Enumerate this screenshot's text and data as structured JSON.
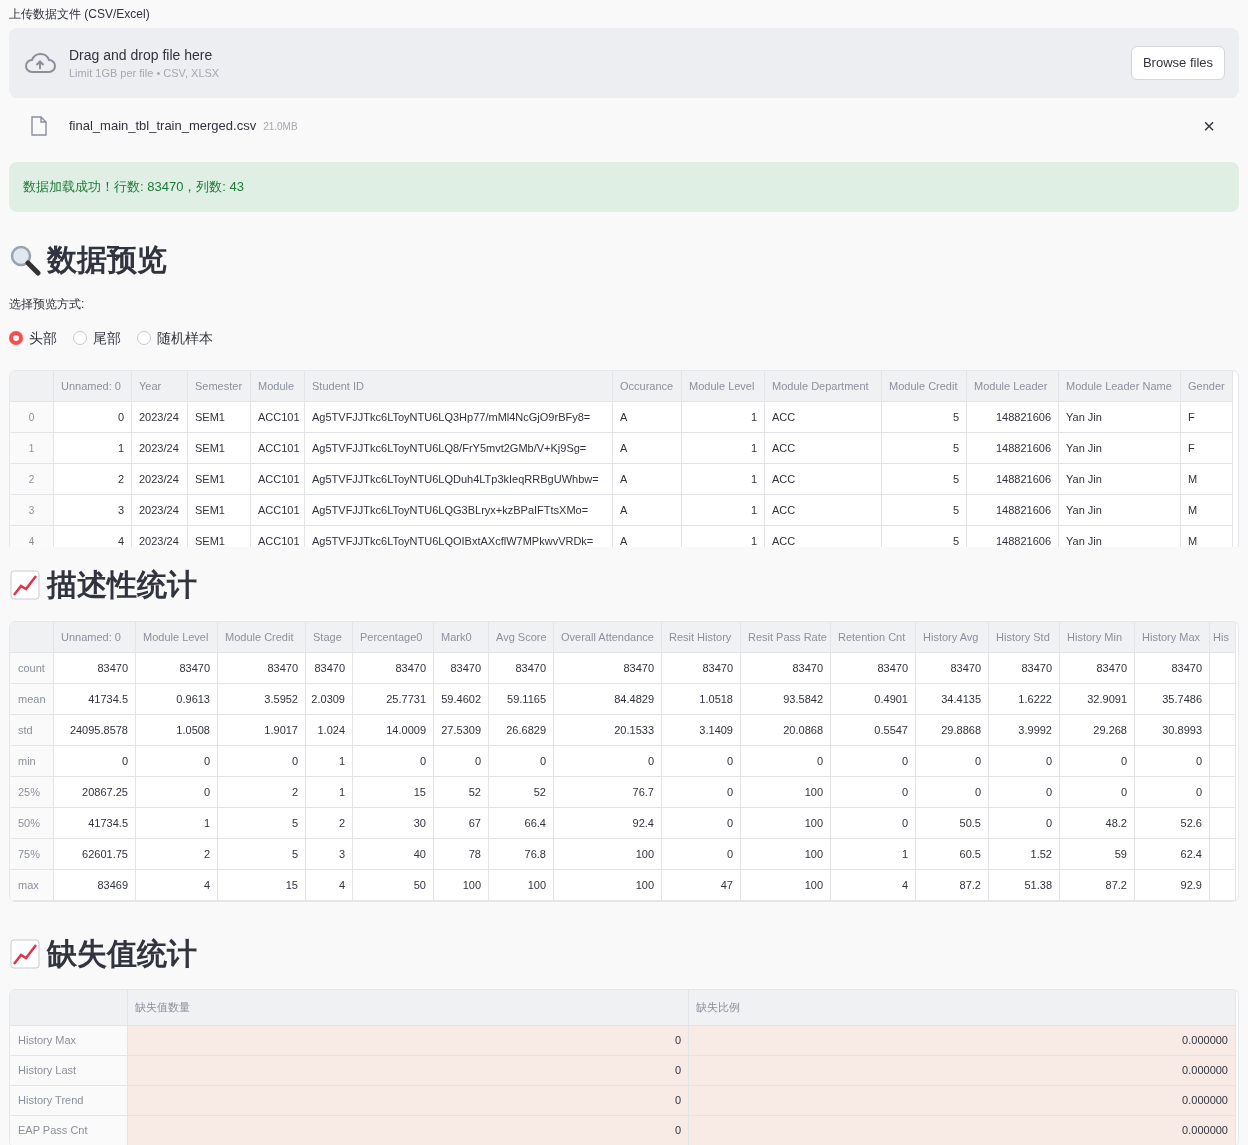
{
  "upload": {
    "label": "上传数据文件 (CSV/Excel)",
    "drop_title": "Drag and drop file here",
    "drop_hint": "Limit 1GB per file • CSV, XLSX",
    "button": "Browse files",
    "file": {
      "name": "final_main_tbl_train_merged.csv",
      "size": "21.0MB",
      "close": "×"
    }
  },
  "alert": {
    "text": "数据加载成功！行数: 83470，列数: 43"
  },
  "preview": {
    "title": "数据预览",
    "mode_label": "选择预览方式:",
    "modes": [
      {
        "label": "头部",
        "selected": true
      },
      {
        "label": "尾部",
        "selected": false
      },
      {
        "label": "随机样本",
        "selected": false
      }
    ],
    "table": {
      "columns": [
        "Unnamed: 0",
        "Year",
        "Semester",
        "Module",
        "Student ID",
        "Occurance",
        "Module Level",
        "Module Department",
        "Module Credit",
        "Module Leader",
        "Module Leader Name",
        "Gender"
      ],
      "rows": [
        {
          "index": "0",
          "cells": [
            "0",
            "2023/24",
            "SEM1",
            "ACC101",
            "Ag5TVFJJTkc6LToyNTU6LQ3Hp77/mMl4NcGjO9rBFy8=",
            "A",
            "1",
            "ACC",
            "5",
            "148821606",
            "Yan Jin",
            "F"
          ]
        },
        {
          "index": "1",
          "cells": [
            "1",
            "2023/24",
            "SEM1",
            "ACC101",
            "Ag5TVFJJTkc6LToyNTU6LQ8/FrY5mvt2GMb/V+Kj9Sg=",
            "A",
            "1",
            "ACC",
            "5",
            "148821606",
            "Yan Jin",
            "F"
          ]
        },
        {
          "index": "2",
          "cells": [
            "2",
            "2023/24",
            "SEM1",
            "ACC101",
            "Ag5TVFJJTkc6LToyNTU6LQDuh4LTp3kIeqRRBgUWhbw=",
            "A",
            "1",
            "ACC",
            "5",
            "148821606",
            "Yan Jin",
            "M"
          ]
        },
        {
          "index": "3",
          "cells": [
            "3",
            "2023/24",
            "SEM1",
            "ACC101",
            "Ag5TVFJJTkc6LToyNTU6LQG3BLryx+kzBPaIFTtsXMo=",
            "A",
            "1",
            "ACC",
            "5",
            "148821606",
            "Yan Jin",
            "M"
          ]
        },
        {
          "index": "4",
          "cells": [
            "4",
            "2023/24",
            "SEM1",
            "ACC101",
            "Ag5TVFJJTkc6LToyNTU6LQOIBxtAXcflW7MPkwvVRDk=",
            "A",
            "1",
            "ACC",
            "5",
            "148821606",
            "Yan Jin",
            "M"
          ]
        }
      ]
    }
  },
  "stats": {
    "title": "描述性统计",
    "table": {
      "columns": [
        "Unnamed: 0",
        "Module Level",
        "Module Credit",
        "Stage",
        "Percentage0",
        "Mark0",
        "Avg Score",
        "Overall Attendance",
        "Resit History",
        "Resit Pass Rate",
        "Retention Cnt",
        "History Avg",
        "History Std",
        "History Min",
        "History Max",
        "His"
      ],
      "rows": [
        {
          "index": "count",
          "cells": [
            "83470",
            "83470",
            "83470",
            "83470",
            "83470",
            "83470",
            "83470",
            "83470",
            "83470",
            "83470",
            "83470",
            "83470",
            "83470",
            "83470",
            "83470"
          ]
        },
        {
          "index": "mean",
          "cells": [
            "41734.5",
            "0.9613",
            "3.5952",
            "2.0309",
            "25.7731",
            "59.4602",
            "59.1165",
            "84.4829",
            "1.0518",
            "93.5842",
            "0.4901",
            "34.4135",
            "1.6222",
            "32.9091",
            "35.7486"
          ]
        },
        {
          "index": "std",
          "cells": [
            "24095.8578",
            "1.0508",
            "1.9017",
            "1.024",
            "14.0009",
            "27.5309",
            "26.6829",
            "20.1533",
            "3.1409",
            "20.0868",
            "0.5547",
            "29.8868",
            "3.9992",
            "29.268",
            "30.8993"
          ]
        },
        {
          "index": "min",
          "cells": [
            "0",
            "0",
            "0",
            "1",
            "0",
            "0",
            "0",
            "0",
            "0",
            "0",
            "0",
            "0",
            "0",
            "0",
            "0"
          ]
        },
        {
          "index": "25%",
          "cells": [
            "20867.25",
            "0",
            "2",
            "1",
            "15",
            "52",
            "52",
            "76.7",
            "0",
            "100",
            "0",
            "0",
            "0",
            "0",
            "0"
          ]
        },
        {
          "index": "50%",
          "cells": [
            "41734.5",
            "1",
            "5",
            "2",
            "30",
            "67",
            "66.4",
            "92.4",
            "0",
            "100",
            "0",
            "50.5",
            "0",
            "48.2",
            "52.6"
          ]
        },
        {
          "index": "75%",
          "cells": [
            "62601.75",
            "2",
            "5",
            "3",
            "40",
            "78",
            "76.8",
            "100",
            "0",
            "100",
            "1",
            "60.5",
            "1.52",
            "59",
            "62.4"
          ]
        },
        {
          "index": "max",
          "cells": [
            "83469",
            "4",
            "15",
            "4",
            "50",
            "100",
            "100",
            "100",
            "47",
            "100",
            "4",
            "87.2",
            "51.38",
            "87.2",
            "92.9"
          ]
        }
      ]
    }
  },
  "missing": {
    "title": "缺失值统计",
    "table": {
      "columns": [
        "缺失值数量",
        "缺失比例"
      ],
      "rows": [
        {
          "index": "History Max",
          "cells": [
            "0",
            "0.000000"
          ]
        },
        {
          "index": "History Last",
          "cells": [
            "0",
            "0.000000"
          ]
        },
        {
          "index": "History Trend",
          "cells": [
            "0",
            "0.000000"
          ]
        },
        {
          "index": "EAP Pass Cnt",
          "cells": [
            "0",
            "0.000000"
          ]
        }
      ]
    }
  }
}
